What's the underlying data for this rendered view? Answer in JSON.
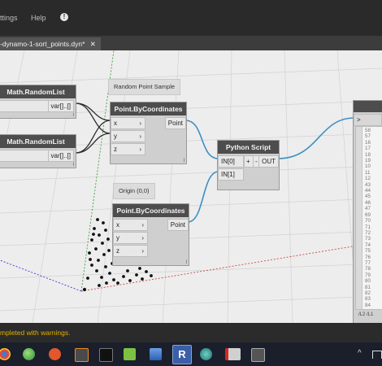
{
  "menu": {
    "settings": "ttings",
    "help": "Help",
    "warn_glyph": "!"
  },
  "tab": {
    "title": "-dynamo-1-sort_points.dyn*",
    "close": "✕"
  },
  "notes": {
    "random_point_sample": "Random Point Sample",
    "origin": "Origin (0,0)"
  },
  "nodes": {
    "random_list_1": {
      "title": "Math.RandomList",
      "output": "var[]..[]",
      "lace": "l"
    },
    "random_list_2": {
      "title": "Math.RandomList",
      "output": "var[]..[]",
      "lace": "l"
    },
    "point_by_coords_1": {
      "title": "Point.ByCoordinates",
      "inputs": [
        "x",
        "y",
        "z"
      ],
      "output": "Point",
      "lace": "l"
    },
    "point_by_coords_2": {
      "title": "Point.ByCoordinates",
      "inputs": [
        "x",
        "y",
        "z"
      ],
      "output": "Point",
      "lace": "l"
    },
    "python_script": {
      "title": "Python Script",
      "inputs": [
        "IN[0]",
        "IN[1]"
      ],
      "plus": "+",
      "minus": "-",
      "output": "OUT"
    },
    "watch": {
      "input_port": ">",
      "items": [
        "58",
        "57",
        "16",
        "17",
        "18",
        "19",
        "10",
        "11",
        "12",
        "43",
        "44",
        "45",
        "46",
        "47",
        "69",
        "70",
        "71",
        "72",
        "73",
        "74",
        "75",
        "76",
        "77",
        "78",
        "79",
        "80",
        "81",
        "82",
        "83",
        "84"
      ],
      "footer": "/L2 /L1"
    }
  },
  "status": {
    "text": "mpleted with warnings."
  },
  "taskbar": {
    "icons": [
      "chrome-icon",
      "green-orb-icon",
      "ubuntu-icon",
      "sublime-icon",
      "terminal-icon",
      "tree-icon",
      "network-icon",
      "revit-icon",
      "globe-icon",
      "pdf-icon",
      "monitor-icon"
    ],
    "revit_letter": "R",
    "tray_arrow": "^"
  },
  "colors": {
    "wire": "#3a8fc4",
    "header": "#4d4d4d",
    "status_text": "#e0b200",
    "x_axis": "#d04848",
    "y_axis": "#3aa13a",
    "z_axis": "#3a3ad0"
  }
}
